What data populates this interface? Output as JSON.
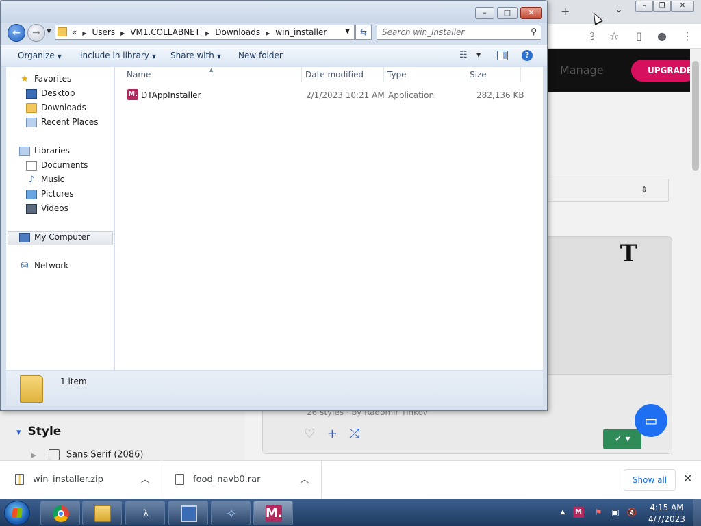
{
  "browser": {
    "new_tab_icon": "+",
    "tab_list_icon": "⌄",
    "toolbar_icons": [
      "share-icon",
      "star-icon",
      "side-panel-icon",
      "profile-icon",
      "menu-icon"
    ],
    "site": {
      "manage_label": "Manage",
      "upgrade_label": "UPGRADE",
      "card_meta": "26 styles · by Radomir Tinkov",
      "style_heading": "Style",
      "filter_option": "Sans Serif (2086)",
      "accent_color": "#d6105e"
    }
  },
  "explorer": {
    "address": {
      "overflow": "«",
      "crumbs": [
        "Users",
        "VM1.COLLABNET",
        "Downloads",
        "win_installer"
      ]
    },
    "search_placeholder": "Search win_installer",
    "commands": {
      "organize": "Organize",
      "include_in_library": "Include in library",
      "share_with": "Share with",
      "new_folder": "New folder"
    },
    "nav": {
      "favorites": "Favorites",
      "desktop": "Desktop",
      "downloads": "Downloads",
      "recent_places": "Recent Places",
      "libraries": "Libraries",
      "documents": "Documents",
      "music": "Music",
      "pictures": "Pictures",
      "videos": "Videos",
      "my_computer": "My Computer",
      "network": "Network"
    },
    "columns": {
      "name": "Name",
      "date_modified": "Date modified",
      "type": "Type",
      "size": "Size"
    },
    "files": [
      {
        "name": "DTAppInstaller",
        "date_modified": "2/1/2023 10:21 AM",
        "type": "Application",
        "size": "282,136 KB",
        "icon_label": "M."
      }
    ],
    "status": "1 item"
  },
  "downloads_bar": {
    "items": [
      {
        "name": "win_installer.zip"
      },
      {
        "name": "food_navb0.rar"
      }
    ],
    "show_all": "Show all"
  },
  "taskbar": {
    "apps": [
      "chrome",
      "windows-explorer",
      "ildasm",
      "config-tool",
      "visual-studio-tool",
      "mylio-m"
    ],
    "clock": {
      "time": "4:15 AM",
      "date": "4/7/2023"
    }
  }
}
